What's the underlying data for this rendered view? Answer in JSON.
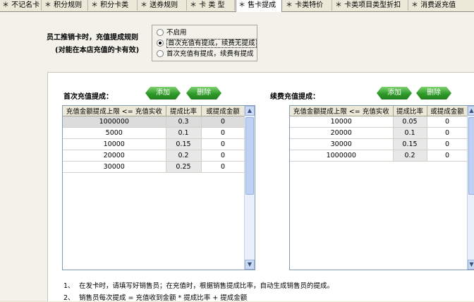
{
  "tabs": [
    {
      "label": "＊ 不记名卡",
      "active": false
    },
    {
      "label": "＊ 积分规则",
      "active": false
    },
    {
      "label": "＊ 积分卡类",
      "active": false
    },
    {
      "label": "＊ 送券规则",
      "active": false
    },
    {
      "label": "＊ 卡 类 型",
      "active": false
    },
    {
      "label": "＊ 售卡提成",
      "active": true
    },
    {
      "label": "＊ 卡类特价",
      "active": false
    },
    {
      "label": "＊ 卡类项目类型折扣",
      "active": false
    },
    {
      "label": "＊ 消费返充值",
      "active": false
    }
  ],
  "rule": {
    "title": "员工推销卡时，充值提成规则",
    "subtitle": "(对能在本店充值的卡有效)",
    "options": [
      {
        "label": "不启用",
        "selected": false
      },
      {
        "label": "首次充值有提成，续费无提成",
        "selected": true
      },
      {
        "label": "首次充值有提成，续费有提成",
        "selected": false
      }
    ]
  },
  "first_recharge": {
    "title": "首次充值提成：",
    "add_label": "添加",
    "delete_label": "删除",
    "columns": [
      "充值金额提成上限 <= 充值实收",
      "提成比率",
      "或提成金额"
    ],
    "rows": [
      [
        "1000000",
        "0.3",
        "0"
      ],
      [
        "5000",
        "0.1",
        "0"
      ],
      [
        "10000",
        "0.15",
        "0"
      ],
      [
        "20000",
        "0.2",
        "0"
      ],
      [
        "30000",
        "0.25",
        "0"
      ]
    ]
  },
  "renew_recharge": {
    "title": "续费充值提成：",
    "add_label": "添加",
    "delete_label": "删除",
    "columns": [
      "充值金额提成上限 <= 充值实收",
      "提成比率",
      "或提成金额"
    ],
    "rows": [
      [
        "10000",
        "0.05",
        "0"
      ],
      [
        "20000",
        "0.1",
        "0"
      ],
      [
        "30000",
        "0.15",
        "0"
      ],
      [
        "1000000",
        "0.2",
        "0"
      ]
    ]
  },
  "notes": [
    {
      "num": "1、",
      "text": "在发卡时，请填写好销售员；在充值时，根据销售提成比率，自动生成销售员的提成。"
    },
    {
      "num": "2、",
      "text": "销售员每次提成 = 充值收到金额 * 提成比率 + 提成金额"
    }
  ]
}
